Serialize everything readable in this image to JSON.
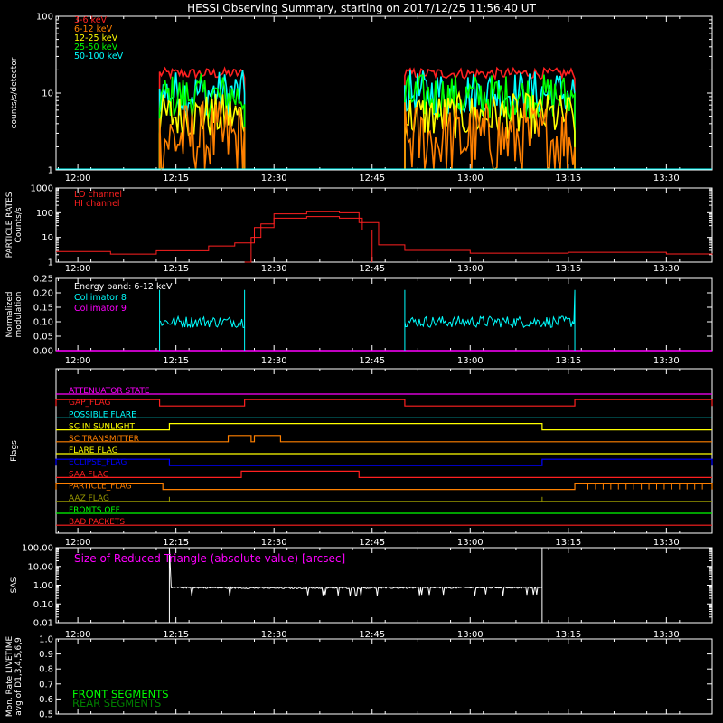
{
  "title": "HESSI Observing Summary, starting on 2017/12/25 11:56:40 UT",
  "time_ticks": [
    "12:00",
    "12:15",
    "12:30",
    "12:45",
    "13:00",
    "13:15",
    "13:30"
  ],
  "colors": {
    "red": "#ff2020",
    "orange": "#ff8000",
    "yellow": "#ffff00",
    "green": "#00ff00",
    "cyan": "#00ffff",
    "magenta": "#ff00ff",
    "blue": "#0000ff",
    "darkred": "#cc0000",
    "olive": "#999900",
    "darkgreen": "#008000",
    "white": "#ffffff"
  },
  "chart_data": [
    {
      "type": "line",
      "panel": "count-rates",
      "ylabel": "counts/s/detector",
      "ylim": [
        1,
        100
      ],
      "yscale": "log",
      "yticks": [
        "1",
        "10",
        "100"
      ],
      "x_unit": "UT time",
      "xlim": [
        "11:56:40",
        "13:37:00"
      ],
      "legend_position": "top-left",
      "data_intervals": [
        [
          "12:12:30",
          "12:25:30"
        ],
        [
          "12:50:00",
          "13:16:00"
        ]
      ],
      "series": [
        {
          "name": "3-6 keV",
          "color": "#ff2020",
          "level": 18
        },
        {
          "name": "6-12 keV",
          "color": "#ff8000",
          "level": 2.5
        },
        {
          "name": "12-25 keV",
          "color": "#ffff00",
          "level": 5
        },
        {
          "name": "25-50 keV",
          "color": "#00ff00",
          "level": 9
        },
        {
          "name": "50-100 keV",
          "color": "#00ffff",
          "level": 10
        }
      ]
    },
    {
      "type": "line",
      "panel": "particle-rates",
      "ylabel_lines": [
        "PARTICLE RATES",
        "Counts/s"
      ],
      "ylim": [
        1,
        1000
      ],
      "yscale": "log",
      "yticks": [
        "1",
        "10",
        "100",
        "1000"
      ],
      "legend_position": "top-left",
      "series": [
        {
          "name": "LO channel",
          "color": "#ff2020",
          "x": [
            "11:56:40",
            "12:05:00",
            "12:12:00",
            "12:20:00",
            "12:24:00",
            "12:27:00",
            "12:30:00",
            "12:35:00",
            "12:40:00",
            "12:43:00",
            "12:46:00",
            "12:50:00",
            "13:00:00",
            "13:15:00",
            "13:30:00",
            "13:37:00"
          ],
          "y": [
            2.5,
            2.5,
            3.2,
            4.5,
            6,
            25,
            90,
            110,
            100,
            40,
            5,
            3,
            2.5,
            2.5,
            2,
            2
          ]
        },
        {
          "name": "HI channel",
          "color": "#ff2020",
          "x": [
            "12:25:30",
            "12:26:30",
            "12:28:00",
            "12:30:00",
            "12:35:00",
            "12:40:00",
            "12:43:30",
            "12:45:00"
          ],
          "y": [
            1,
            10,
            35,
            60,
            70,
            60,
            20,
            1
          ]
        }
      ]
    },
    {
      "type": "line",
      "panel": "modulation",
      "ylabel_lines": [
        "Normalized",
        "modulation"
      ],
      "ylim": [
        0,
        0.25
      ],
      "yticks": [
        "0.00",
        "0.05",
        "0.10",
        "0.15",
        "0.20",
        "0.25"
      ],
      "annotation": "Energy band: 6-12 keV",
      "legend_position": "top-left",
      "series": [
        {
          "name": "Collimator 8",
          "color": "#00ffff",
          "level": 0.1,
          "data_intervals": [
            [
              "12:12:30",
              "12:25:30"
            ],
            [
              "12:50:00",
              "13:16:00"
            ]
          ]
        },
        {
          "name": "Collimator 9",
          "color": "#ff00ff",
          "level": 0.0
        }
      ]
    },
    {
      "type": "line",
      "panel": "flags",
      "ylabel": "Flags",
      "flags": [
        {
          "name": "ATTENUATOR STATE",
          "color": "#ff00ff",
          "on": []
        },
        {
          "name": "GAP_FLAG",
          "color": "#ff2020",
          "on": [
            [
              "11:56:40",
              "12:12:30"
            ],
            [
              "12:25:30",
              "12:50:00"
            ],
            [
              "13:16:00",
              "13:37:00"
            ]
          ]
        },
        {
          "name": "POSSIBLE FLARE",
          "color": "#00ffff",
          "on": []
        },
        {
          "name": "SC IN SUNLIGHT",
          "color": "#ffff00",
          "on": [
            [
              "12:14:00",
              "13:11:00"
            ]
          ]
        },
        {
          "name": "SC TRANSMITTER",
          "color": "#ff8000",
          "on": [
            [
              "12:23:00",
              "12:26:30"
            ],
            [
              "12:27:00",
              "12:31:00"
            ]
          ]
        },
        {
          "name": "FLARE FLAG",
          "color": "#ffff00",
          "on": []
        },
        {
          "name": "ECLIPSE_FLAG",
          "color": "#0000ff",
          "on": [
            [
              "11:56:40",
              "12:14:00"
            ],
            [
              "13:11:00",
              "13:37:00"
            ]
          ]
        },
        {
          "name": "SAA FLAG",
          "color": "#ff2020",
          "on": [
            [
              "12:25:00",
              "12:43:00"
            ]
          ]
        },
        {
          "name": "PARTICLE_FLAG",
          "color": "#ff8000",
          "on": [
            [
              "11:56:40",
              "12:13:00"
            ],
            [
              "13:16:00",
              "13:37:00"
            ]
          ]
        },
        {
          "name": "AAZ FLAG",
          "color": "#999900",
          "on": []
        },
        {
          "name": "FRONTS OFF",
          "color": "#00ff00",
          "on": []
        },
        {
          "name": "BAD PACKETS",
          "color": "#ff2020",
          "on": []
        }
      ]
    },
    {
      "type": "line",
      "panel": "sas",
      "ylabel": "SAS",
      "ylim": [
        0.01,
        100
      ],
      "yscale": "log",
      "yticks": [
        "0.01",
        "0.10",
        "1.00",
        "10.00",
        "100.00"
      ],
      "annotation": "Size of Reduced Triangle (absolute value) [arcsec]",
      "series": [
        {
          "color": "#ffffff",
          "x": [
            "12:14:00",
            "12:15:00",
            "12:30:00",
            "12:45:00",
            "13:00:00",
            "13:11:00"
          ],
          "y": [
            0.7,
            0.75,
            0.7,
            0.72,
            0.74,
            0.75
          ]
        }
      ]
    },
    {
      "type": "line",
      "panel": "livetime",
      "ylabel_lines": [
        "Mon. Rate LIVETIME",
        "avg of D1,3,4,5,6,9"
      ],
      "ylim": [
        0.5,
        1.0
      ],
      "yticks": [
        "0.5",
        "0.6",
        "0.7",
        "0.8",
        "0.9",
        "1.0"
      ],
      "legend_position": "bottom-left",
      "series": [
        {
          "name": "FRONT SEGMENTS",
          "color": "#00ff00"
        },
        {
          "name": "REAR SEGMENTS",
          "color": "#008000"
        }
      ]
    }
  ]
}
